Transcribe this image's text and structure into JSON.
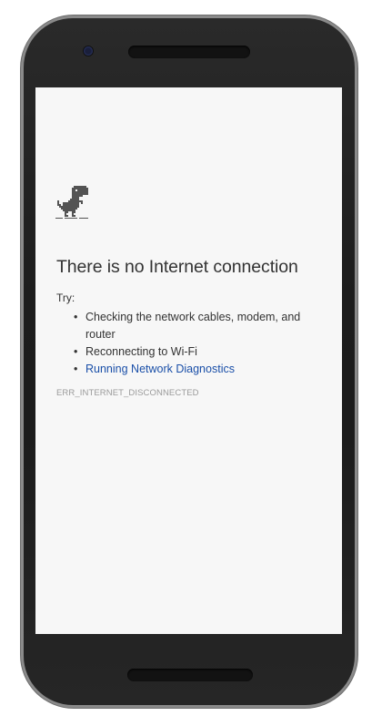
{
  "error_page": {
    "title": "There is no Internet connection",
    "try_label": "Try:",
    "suggestions": [
      {
        "text": "Checking the network cables, modem, and router",
        "is_link": false
      },
      {
        "text": "Reconnecting to Wi-Fi",
        "is_link": false
      },
      {
        "text": "Running Network Diagnostics",
        "is_link": true
      }
    ],
    "bullet": "•",
    "error_code": "ERR_INTERNET_DISCONNECTED",
    "icon": "offline-dinosaur-icon"
  },
  "colors": {
    "text": "#333333",
    "link": "#1a4fa8",
    "error_code": "#9a9a9a",
    "screen_background": "#f7f7f7",
    "device_body": "#1f1f1f"
  }
}
